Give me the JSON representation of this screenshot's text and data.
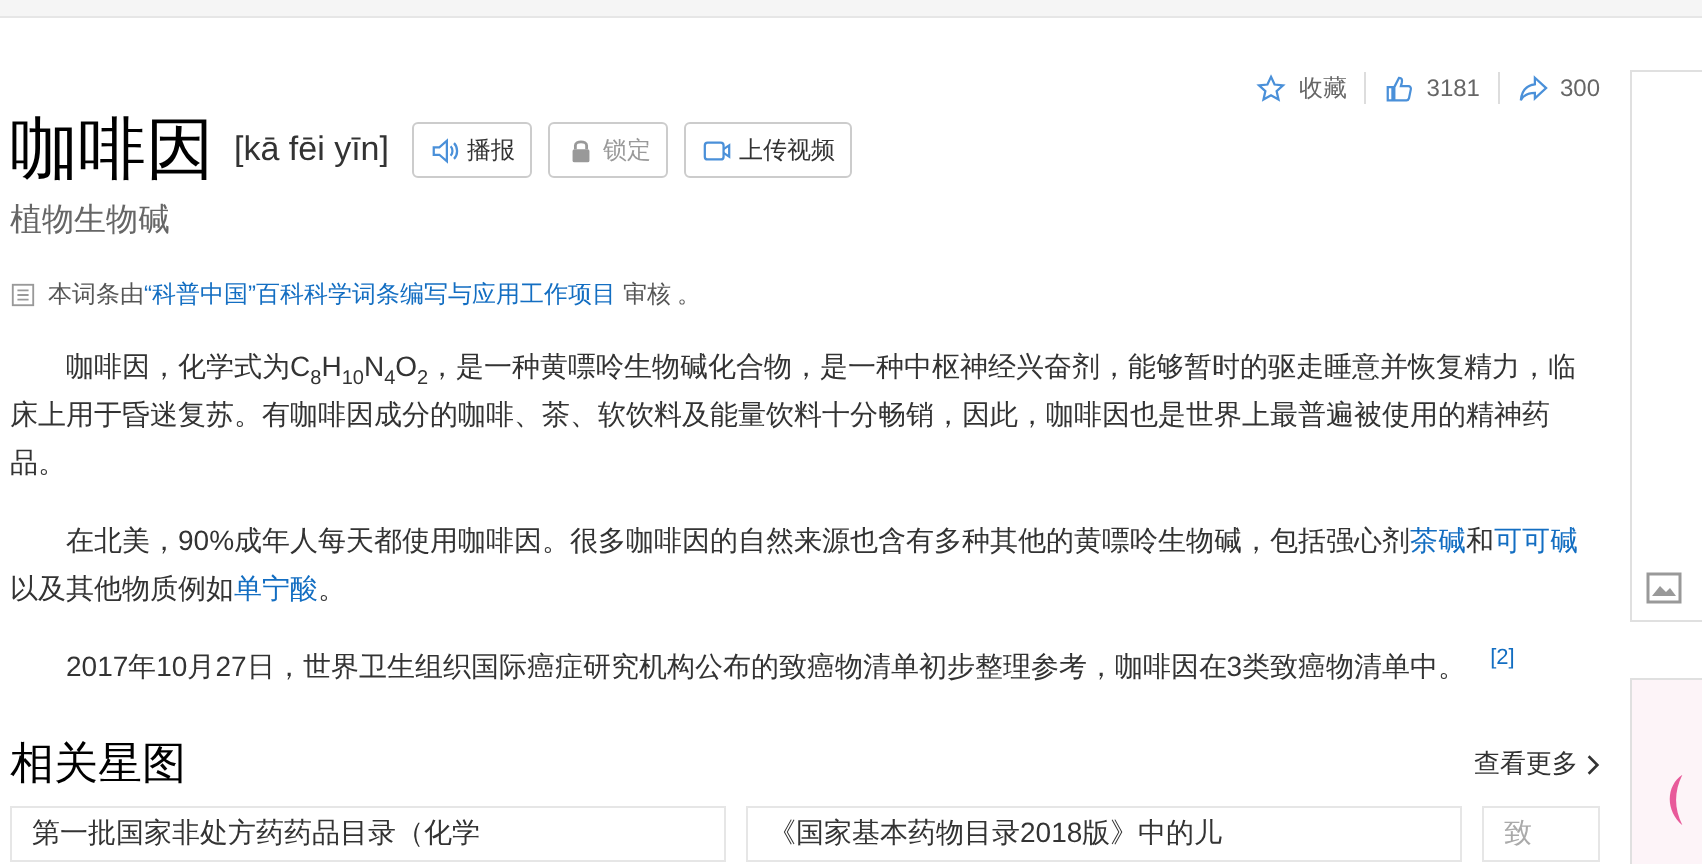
{
  "actions": [
    {
      "kind": "favorite",
      "label": "收藏"
    },
    {
      "kind": "like",
      "label": "3181"
    },
    {
      "kind": "share",
      "label": "300"
    }
  ],
  "title": "咖啡因",
  "pinyin": "[kā fēi yīn]",
  "buttons": [
    {
      "kind": "audio",
      "label": "播报",
      "disabled": false
    },
    {
      "kind": "lock",
      "label": "锁定",
      "disabled": true
    },
    {
      "kind": "video",
      "label": "上传视频",
      "disabled": false
    }
  ],
  "subtitle": "植物生物碱",
  "review": {
    "before": "本词条由",
    "link": "“科普中国”百科科学词条编写与应用工作项目",
    "after": " 审核 。"
  },
  "paragraphs": [
    {
      "segments": [
        {
          "kind": "text",
          "text": "咖啡因，化学式为C$_{8}$H$_{10}$N$_{4}$O$_{2}$，是一种黄嘌呤生物碱化合物，是一种中枢神经兴奋剂，能够暂时的驱走睡意并恢复精力，临床上用于昏迷复苏。有咖啡因成分的咖啡、茶、软饮料及能量饮料十分畅销，因此，咖啡因也是世界上最普遍被使用的精神药品。"
        }
      ]
    },
    {
      "segments": [
        {
          "kind": "text",
          "text": "在北美，90%成年人每天都使用咖啡因。很多咖啡因的自然来源也含有多种其他的黄嘌呤生物碱，包括强心剂"
        },
        {
          "kind": "link",
          "text": "茶碱"
        },
        {
          "kind": "text",
          "text": "和"
        },
        {
          "kind": "link",
          "text": "可可碱"
        },
        {
          "kind": "text",
          "text": "以及其他物质例如"
        },
        {
          "kind": "link",
          "text": "单宁酸"
        },
        {
          "kind": "text",
          "text": "。"
        }
      ]
    },
    {
      "segments": [
        {
          "kind": "text",
          "text": "2017年10月27日，世界卫生组织国际癌症研究机构公布的致癌物清单初步整理参考，咖啡因在3类致癌物清单中。"
        },
        {
          "kind": "reference",
          "text": "[2]"
        }
      ]
    }
  ],
  "related": {
    "heading": "相关星图",
    "more": "查看更多",
    "cards": [
      {
        "title": "第一批国家非处方药药品目录（化学"
      },
      {
        "title": "《国家基本药物目录2018版》中的儿"
      },
      {
        "title": "致"
      }
    ]
  }
}
